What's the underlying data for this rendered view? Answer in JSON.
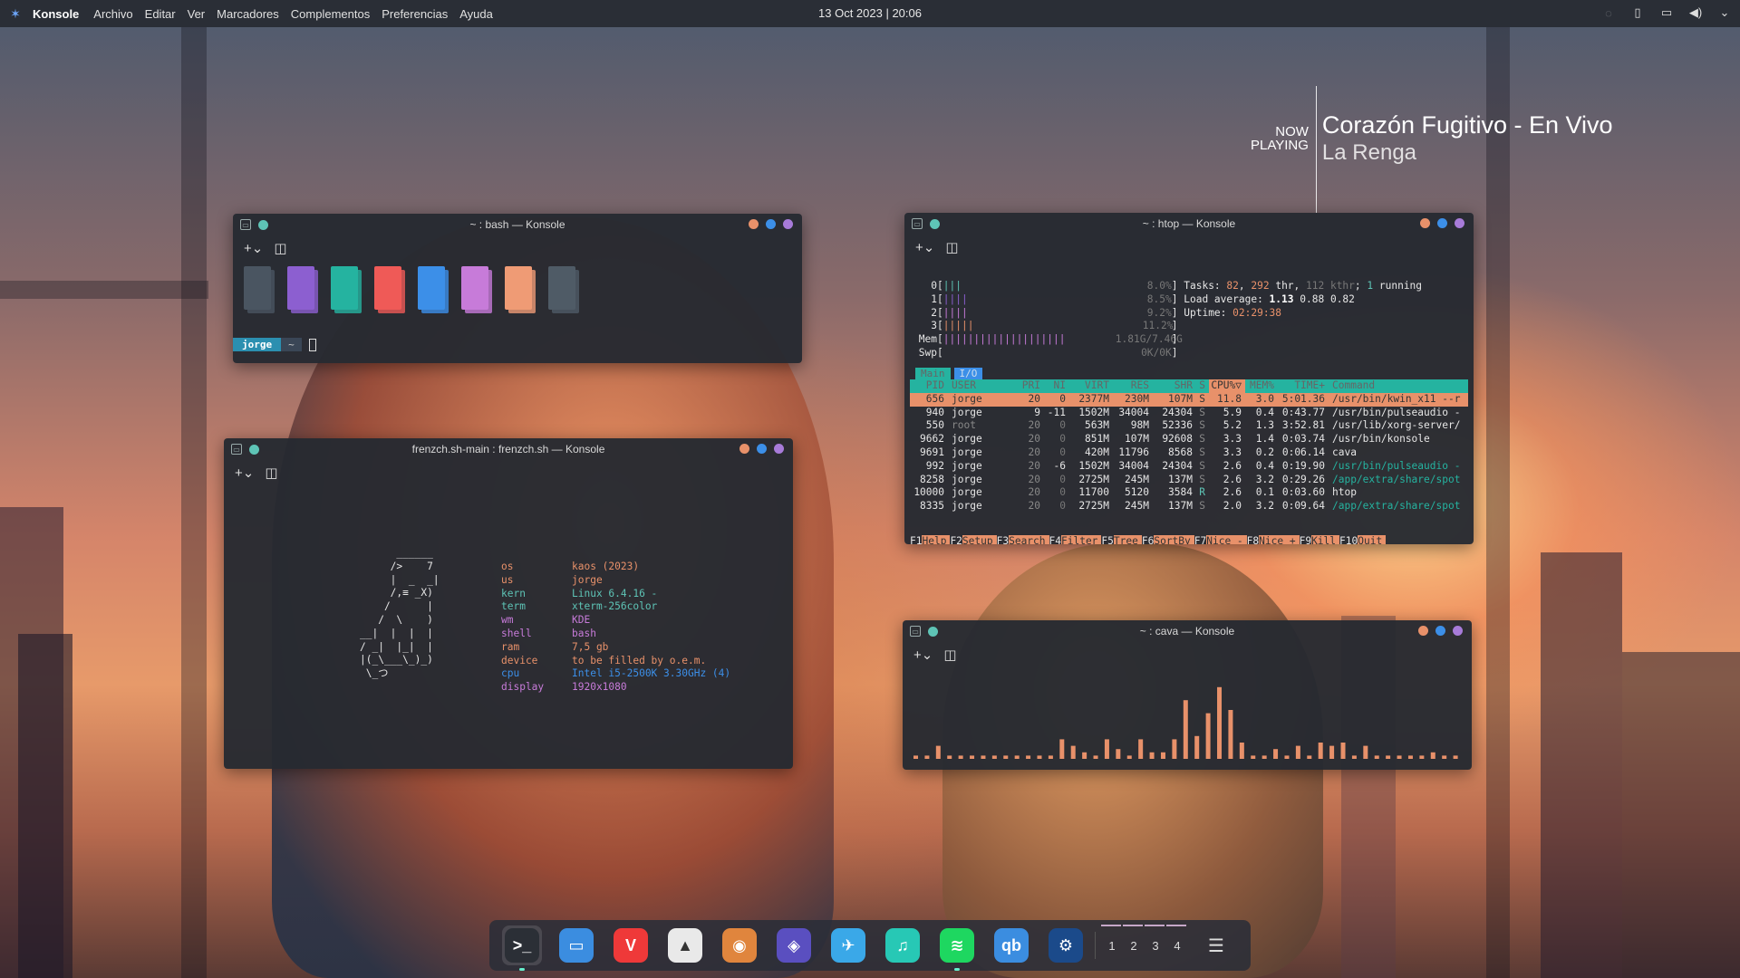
{
  "panel": {
    "app_name": "Konsole",
    "menus": [
      "Archivo",
      "Editar",
      "Ver",
      "Marcadores",
      "Complementos",
      "Preferencias",
      "Ayuda"
    ],
    "clock": "13 Oct 2023 | 20:06"
  },
  "now_playing": {
    "label_line1": "NOW",
    "label_line2": "PLAYING",
    "title": "Corazón Fugitivo - En Vivo",
    "artist": "La Renga"
  },
  "bash_window": {
    "title": "~ : bash — Konsole",
    "prompt_user": "jorge",
    "prompt_dir": "~",
    "swatches": [
      "#4a5561",
      "#8c5fd0",
      "#25b3a0",
      "#ef5a57",
      "#3c8fe8",
      "#c77bd9",
      "#ef9b75",
      "#4f5b66"
    ]
  },
  "neofetch_window": {
    "title": "frenzch.sh-main : frenzch.sh — Konsole",
    "ascii": "      ______\n     />    7\n     |  _  _|\n     /,≡ _X)\n    /      |\n   /  \\    )\n__|  |  |  |\n/ _|  |_|  |\n|(_\\___\\_)_)\n \\_つ",
    "info": [
      {
        "key": "os",
        "value": "kaos (2023)",
        "color": "#e8916a"
      },
      {
        "key": "us",
        "value": "jorge",
        "color": "#e8916a"
      },
      {
        "key": "kern",
        "value": "Linux 6.4.16 -",
        "color": "#5ec4b6"
      },
      {
        "key": "term",
        "value": "xterm-256color",
        "color": "#5ec4b6"
      },
      {
        "key": "wm",
        "value": "KDE",
        "color": "#c77bd9"
      },
      {
        "key": "shell",
        "value": "bash",
        "color": "#c77bd9"
      },
      {
        "key": "ram",
        "value": "7,5 gb",
        "color": "#e8916a"
      },
      {
        "key": "device",
        "value": "to be filled by o.e.m.",
        "color": "#e8916a"
      },
      {
        "key": "cpu",
        "value": "Intel i5-2500K 3.30GHz (4)",
        "color": "#3c8fe8"
      },
      {
        "key": "display",
        "value": "1920x1080",
        "color": "#c77bd9"
      }
    ]
  },
  "htop_window": {
    "title": "~ : htop — Konsole",
    "cpus": [
      {
        "id": "0",
        "bar": "|||",
        "pct": "8.0%"
      },
      {
        "id": "1",
        "bar": "||||",
        "pct": "8.5%"
      },
      {
        "id": "2",
        "bar": "||||",
        "pct": "9.2%"
      },
      {
        "id": "3",
        "bar": "|||||",
        "pct": "11.2%"
      }
    ],
    "mem": {
      "label": "Mem",
      "bar": "||||||||||||||||||||",
      "value": "1.81G/7.46G"
    },
    "swp": {
      "label": "Swp",
      "value": "0K/0K"
    },
    "tasks": {
      "prefix": "Tasks: ",
      "tasks": "82",
      "sep": ", ",
      "thr": "292",
      "thr_label": " thr, ",
      "kthr": "112 kthr",
      "mid": "; ",
      "running": "1",
      "run_label": " running"
    },
    "load": {
      "label": "Load average: ",
      "v1": "1.13",
      "v2": "0.88",
      "v3": "0.82"
    },
    "uptime": {
      "label": "Uptime: ",
      "value": "02:29:38"
    },
    "tabs": [
      "Main",
      "I/O"
    ],
    "columns": [
      "PID",
      "USER",
      "PRI",
      "NI",
      "VIRT",
      "RES",
      "SHR",
      "S",
      "CPU%▽",
      "MEM%",
      "TIME+",
      "Command"
    ],
    "processes": [
      [
        "656",
        "jorge",
        "20",
        "0",
        "2377M",
        "230M",
        "107M",
        "S",
        "11.8",
        "3.0",
        "5:01.36",
        "/usr/bin/kwin_x11 --r"
      ],
      [
        "940",
        "jorge",
        "9",
        "-11",
        "1502M",
        "34004",
        "24304",
        "S",
        "5.9",
        "0.4",
        "0:43.77",
        "/usr/bin/pulseaudio -"
      ],
      [
        "550",
        "root",
        "20",
        "0",
        "563M",
        "98M",
        "52336",
        "S",
        "5.2",
        "1.3",
        "3:52.81",
        "/usr/lib/xorg-server/"
      ],
      [
        "9662",
        "jorge",
        "20",
        "0",
        "851M",
        "107M",
        "92608",
        "S",
        "3.3",
        "1.4",
        "0:03.74",
        "/usr/bin/konsole"
      ],
      [
        "9691",
        "jorge",
        "20",
        "0",
        "420M",
        "11796",
        "8568",
        "S",
        "3.3",
        "0.2",
        "0:06.14",
        "cava"
      ],
      [
        "992",
        "jorge",
        "20",
        "-6",
        "1502M",
        "34004",
        "24304",
        "S",
        "2.6",
        "0.4",
        "0:19.90",
        "/usr/bin/pulseaudio -"
      ],
      [
        "8258",
        "jorge",
        "20",
        "0",
        "2725M",
        "245M",
        "137M",
        "S",
        "2.6",
        "3.2",
        "0:29.26",
        "/app/extra/share/spot"
      ],
      [
        "10000",
        "jorge",
        "20",
        "0",
        "11700",
        "5120",
        "3584",
        "R",
        "2.6",
        "0.1",
        "0:03.60",
        "htop"
      ],
      [
        "8335",
        "jorge",
        "20",
        "0",
        "2725M",
        "245M",
        "137M",
        "S",
        "2.0",
        "3.2",
        "0:09.64",
        "/app/extra/share/spot"
      ]
    ],
    "fkeys": [
      {
        "k": "F1",
        "l": "Help"
      },
      {
        "k": "F2",
        "l": "Setup"
      },
      {
        "k": "F3",
        "l": "Search"
      },
      {
        "k": "F4",
        "l": "Filter"
      },
      {
        "k": "F5",
        "l": "Tree"
      },
      {
        "k": "F6",
        "l": "SortBy"
      },
      {
        "k": "F7",
        "l": "Nice -"
      },
      {
        "k": "F8",
        "l": "Nice +"
      },
      {
        "k": "F9",
        "l": "Kill"
      },
      {
        "k": "F10",
        "l": "Quit"
      }
    ]
  },
  "cava_window": {
    "title": "~ : cava — Konsole",
    "levels": [
      1,
      1,
      4,
      1,
      1,
      1,
      1,
      1,
      1,
      1,
      1,
      1,
      1,
      6,
      4,
      2,
      1,
      6,
      3,
      1,
      6,
      2,
      2,
      6,
      18,
      7,
      14,
      22,
      15,
      5,
      1,
      1,
      3,
      1,
      4,
      1,
      5,
      4,
      5,
      1,
      4,
      1,
      1,
      1,
      1,
      1,
      2,
      1,
      1
    ]
  },
  "dock": {
    "apps": [
      {
        "name": "terminal",
        "glyph": ">_",
        "bg": "#2b2f36"
      },
      {
        "name": "files",
        "glyph": "▭",
        "bg": "#3b8de0"
      },
      {
        "name": "vivaldi",
        "glyph": "V",
        "bg": "#ef3939"
      },
      {
        "name": "inkscape",
        "glyph": "▲",
        "bg": "#e9e9e9"
      },
      {
        "name": "gimp",
        "glyph": "◉",
        "bg": "#e0853d"
      },
      {
        "name": "privacy",
        "glyph": "◈",
        "bg": "#5a4fc0"
      },
      {
        "name": "telegram",
        "glyph": "✈",
        "bg": "#3aa8e8"
      },
      {
        "name": "music",
        "glyph": "♫",
        "bg": "#27c8b5"
      },
      {
        "name": "spotify",
        "glyph": "≋",
        "bg": "#1ed760"
      },
      {
        "name": "qbittorrent",
        "glyph": "qb",
        "bg": "#3b8de0"
      },
      {
        "name": "steam",
        "glyph": "⚙",
        "bg": "#1b4a8a"
      }
    ],
    "workspaces": [
      "1",
      "2",
      "3",
      "4"
    ],
    "menu_glyph": "☰"
  }
}
